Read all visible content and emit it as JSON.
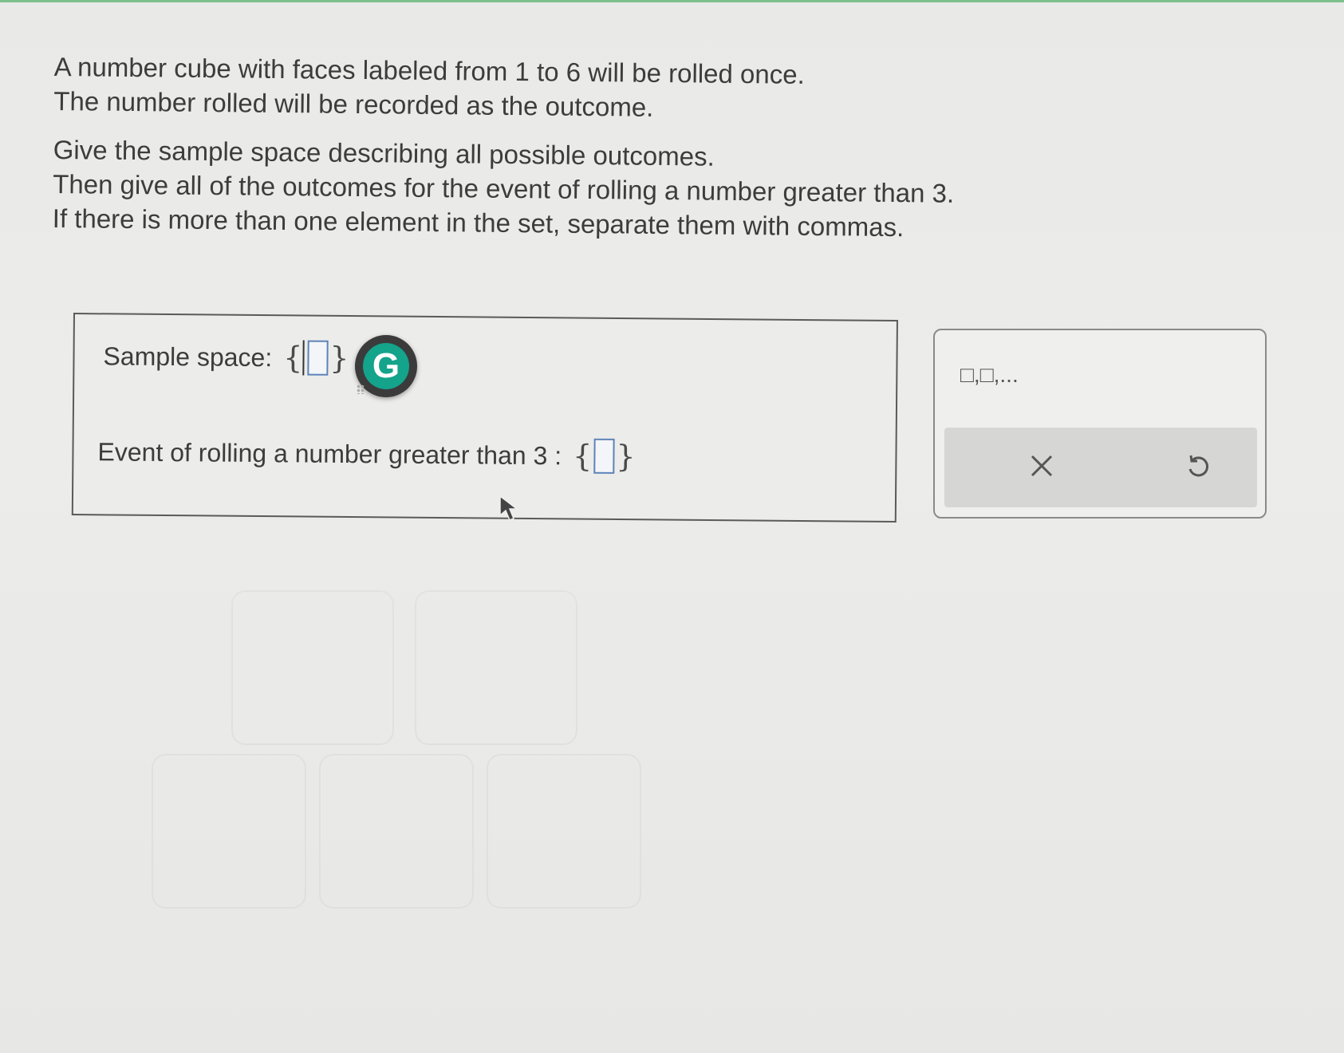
{
  "problem": {
    "line1": "A number cube with faces labeled from 1 to 6 will be rolled once.",
    "line2": "The number rolled will be recorded as the outcome.",
    "line3": "Give the sample space describing all possible outcomes.",
    "line4": "Then give all of the outcomes for the event of rolling a number greater than 3.",
    "line5": "If there is more than one element in the set, separate them with commas."
  },
  "answer": {
    "sample_space_label": "Sample space:",
    "sample_space_value": "",
    "event_label": "Event of rolling a number greater than 3 :",
    "event_value": "",
    "open_brace": "{",
    "close_brace": "}"
  },
  "grammarly": {
    "letter": "G",
    "icon": "grammarly-icon",
    "color": "#14a38b"
  },
  "toolbox": {
    "template_label": "□,□,...",
    "clear_icon": "x-icon",
    "undo_icon": "undo-icon"
  },
  "colors": {
    "accent": "#7dbf8a",
    "input_border": "#5d83b8"
  }
}
